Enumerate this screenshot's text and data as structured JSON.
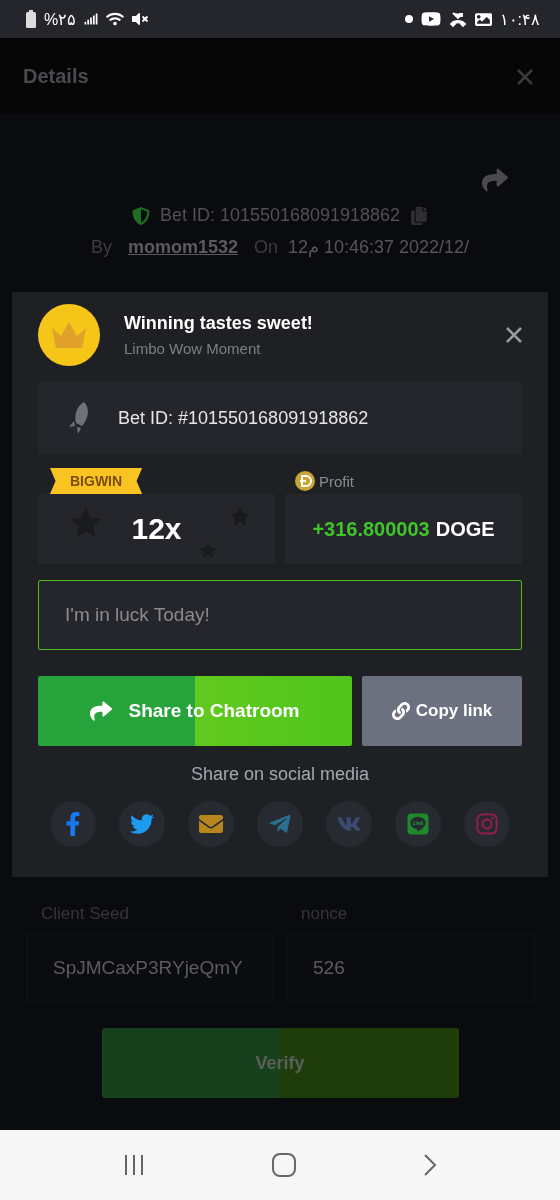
{
  "status_bar": {
    "battery": "%۲۵",
    "time": "۱۰:۴۸"
  },
  "header": {
    "title": "Details"
  },
  "bet": {
    "bet_id": "Bet ID: 101550168091918862",
    "by_label": "By",
    "user": "momom1532",
    "on_label": "On",
    "date": "12م 10:46:37 2022/12/"
  },
  "seed": {
    "client_seed_label": "Client Seed",
    "nonce_label": "nonce",
    "client_seed": "SpJMCaxP3RYjeQmY",
    "nonce": "526",
    "verify": "Verify"
  },
  "modal": {
    "title": "Winning tastes sweet!",
    "subtitle": "Limbo Wow Moment",
    "bet_id": "Bet ID: #101550168091918862",
    "badge": "BIGWIN",
    "multiplier": "12x",
    "profit_label": "Profit",
    "profit_amount": "+316.800003",
    "profit_currency": "DOGE",
    "message_placeholder": "I'm in luck Today!",
    "share_button": "Share to Chatroom",
    "copy_button": "Copy link",
    "social_label": "Share on social media",
    "social": [
      {
        "kind": "facebook",
        "color": "#1877f2"
      },
      {
        "kind": "twitter",
        "color": "#1d9bf0"
      },
      {
        "kind": "mail",
        "color": "#b8861c"
      },
      {
        "kind": "telegram",
        "color": "#2a6f8f"
      },
      {
        "kind": "vk",
        "color": "#3a4a6e"
      },
      {
        "kind": "line",
        "color": "#1f8a2c"
      },
      {
        "kind": "instagram",
        "color": "#9a1d4a"
      }
    ]
  }
}
